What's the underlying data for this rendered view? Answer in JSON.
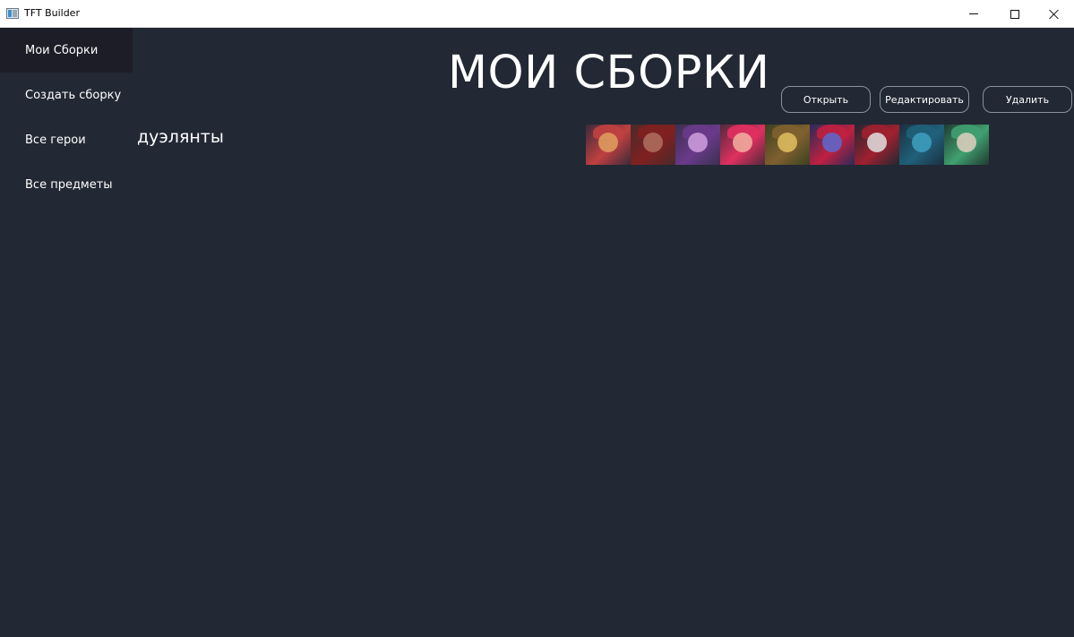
{
  "window": {
    "title": "TFT Builder"
  },
  "sidebar": {
    "items": [
      {
        "label": "Мои Сборки",
        "active": true
      },
      {
        "label": "Создать сборку",
        "active": false
      },
      {
        "label": "Все герои",
        "active": false
      },
      {
        "label": "Все предметы",
        "active": false
      }
    ]
  },
  "main": {
    "title": "МОИ СБОРКИ",
    "actions": {
      "open_label": "Открыть",
      "edit_label": "Редактировать",
      "delete_label": "Удалить"
    },
    "builds": [
      {
        "name": "дуэлянты",
        "champions": [
          {
            "icon": "champion-portrait-1",
            "palette": [
              "#3a2a3a",
              "#e0a060",
              "#c04040"
            ]
          },
          {
            "icon": "champion-portrait-2",
            "palette": [
              "#4a2a2a",
              "#b07060",
              "#802020"
            ]
          },
          {
            "icon": "champion-portrait-3",
            "palette": [
              "#3a3050",
              "#d0a0e0",
              "#6a3a8a"
            ]
          },
          {
            "icon": "champion-portrait-4",
            "palette": [
              "#502a3a",
              "#f0b0a0",
              "#e03060"
            ]
          },
          {
            "icon": "champion-portrait-5",
            "palette": [
              "#3a4020",
              "#e0c060",
              "#806030"
            ]
          },
          {
            "icon": "champion-portrait-6",
            "palette": [
              "#2a2a5a",
              "#5a6ad0",
              "#c02040"
            ]
          },
          {
            "icon": "champion-portrait-7",
            "palette": [
              "#202830",
              "#e0e0e0",
              "#a02030"
            ]
          },
          {
            "icon": "champion-portrait-8",
            "palette": [
              "#1a3040",
              "#40a0c0",
              "#20607a"
            ]
          },
          {
            "icon": "champion-portrait-9",
            "palette": [
              "#203a30",
              "#e0d0c0",
              "#40a070"
            ]
          }
        ]
      }
    ]
  },
  "colors": {
    "background": "#222834",
    "sidebar_active": "#1d1d28",
    "button_border": "#8a93a0",
    "text": "#ffffff"
  }
}
